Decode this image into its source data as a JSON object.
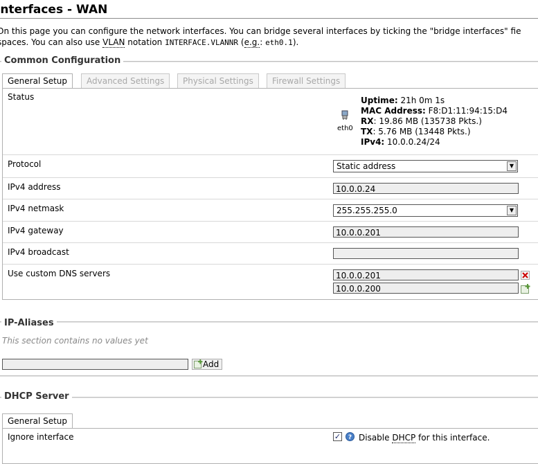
{
  "page": {
    "title": "Interfaces - WAN",
    "intro_line1": "On this page you can configure the network interfaces. You can bridge several interfaces by ticking the \"bridge interfaces\" fie",
    "intro_line2_a": "spaces. You can also use ",
    "intro_vlan": "VLAN",
    "intro_line2_b": " notation ",
    "intro_code1": "INTERFACE.VLANNR",
    "intro_line2_c": " (",
    "intro_eg": "e.g.",
    "intro_line2_d": ": ",
    "intro_code2": "eth0.1",
    "intro_line2_e": ")."
  },
  "common": {
    "legend": "Common Configuration",
    "tabs": [
      {
        "label": "General Setup",
        "active": true
      },
      {
        "label": "Advanced Settings",
        "active": false
      },
      {
        "label": "Physical Settings",
        "active": false
      },
      {
        "label": "Firewall Settings",
        "active": false
      }
    ],
    "status": {
      "label": "Status",
      "iface": "eth0",
      "uptime_k": "Uptime:",
      "uptime_v": " 21h 0m 1s",
      "mac_k": "MAC Address:",
      "mac_v": " F8:D1:11:94:15:D4",
      "rx_k": "RX",
      "rx_v": ": 19.86 MB (135738 Pkts.)",
      "tx_k": "TX",
      "tx_v": ": 5.76 MB (13448 Pkts.)",
      "ipv4_k": "IPv4:",
      "ipv4_v": " 10.0.0.24/24"
    },
    "protocol": {
      "label": "Protocol",
      "value": "Static address"
    },
    "ipv4_address": {
      "label": "IPv4 address",
      "value": "10.0.0.24"
    },
    "ipv4_netmask": {
      "label": "IPv4 netmask",
      "value": "255.255.255.0"
    },
    "ipv4_gateway": {
      "label": "IPv4 gateway",
      "value": "10.0.0.201"
    },
    "ipv4_broadcast": {
      "label": "IPv4 broadcast",
      "value": ""
    },
    "dns": {
      "label": "Use custom DNS servers",
      "values": [
        "10.0.0.201",
        "10.0.0.200"
      ]
    }
  },
  "aliases": {
    "legend": "IP-Aliases",
    "empty_text": "This section contains no values yet",
    "add_value": "",
    "add_label": "Add"
  },
  "dhcp": {
    "legend": "DHCP Server",
    "tab": "General Setup",
    "ignore_label": "Ignore interface",
    "ignore_checked": true,
    "desc_a": "Disable ",
    "desc_dhcp": "DHCP",
    "desc_b": " for this interface."
  },
  "colors": {
    "link_underline": "#000000",
    "inactive_tab_text": "#a8a8a8",
    "remove_icon": "#cc0000",
    "add_icon": "#5a9a3a"
  },
  "icons": [
    "network-port-icon",
    "remove-icon",
    "add-icon",
    "help-icon",
    "dropdown-arrow-icon"
  ]
}
